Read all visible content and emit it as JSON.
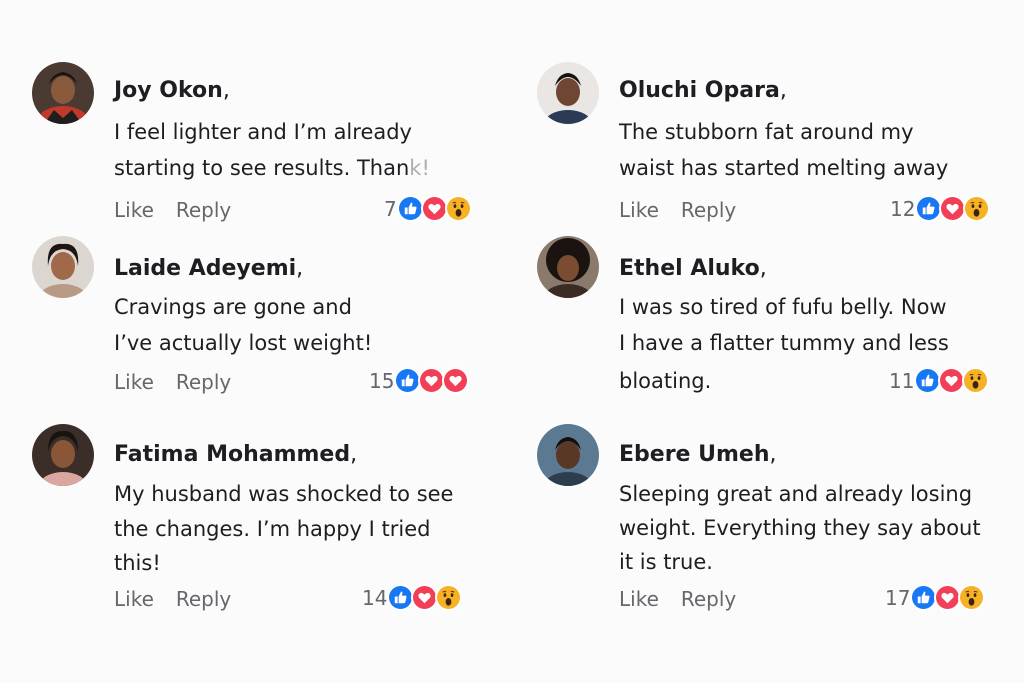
{
  "colors": {
    "like_blue": "#1877f2",
    "love_red": "#f33e58",
    "wow_yellow": "#f7b125",
    "text": "#1c1e21",
    "muted": "#65676b"
  },
  "actions": {
    "like": "Like",
    "reply": "Reply"
  },
  "comments": [
    {
      "name": "Joy Okon",
      "comma": ",",
      "lines": [
        "I feel lighter and I’m already",
        "starting to see results. Than",
        "k!"
      ],
      "count": "7",
      "reactions": [
        "like-icon",
        "love-icon",
        "wow-icon"
      ]
    },
    {
      "name": "Oluchi Opara",
      "comma": ",",
      "lines": [
        "The stubborn fat around my",
        "waist has started melting away"
      ],
      "count": "12",
      "reactions": [
        "like-icon",
        "love-icon",
        "wow-icon"
      ]
    },
    {
      "name": "Laide Adeyemi",
      "comma": ",",
      "lines": [
        "Cravings are gone and",
        "I’ve actually lost weight!"
      ],
      "count": "15",
      "reactions": [
        "like-icon",
        "love-icon",
        "love-icon"
      ]
    },
    {
      "name": "Ethel Aluko",
      "comma": ",",
      "lines": [
        "I was so tired of fufu belly. Now",
        "I have a flatter tummy and less",
        "bloating."
      ],
      "count": "11",
      "reactions": [
        "like-icon",
        "love-icon",
        "wow-icon"
      ]
    },
    {
      "name": "Fatima Mohammed",
      "comma": ",",
      "lines": [
        "My husband was shocked to see",
        "the changes. I’m happy I tried",
        "this!"
      ],
      "count": "14",
      "reactions": [
        "like-icon",
        "love-icon",
        "wow-icon"
      ]
    },
    {
      "name": "Ebere Umeh",
      "comma": ",",
      "lines": [
        "Sleeping great and already losing",
        "weight. Everything they say about",
        "it is true."
      ],
      "count": "17",
      "reactions": [
        "like-icon",
        "love-icon",
        "wow-icon"
      ]
    }
  ]
}
